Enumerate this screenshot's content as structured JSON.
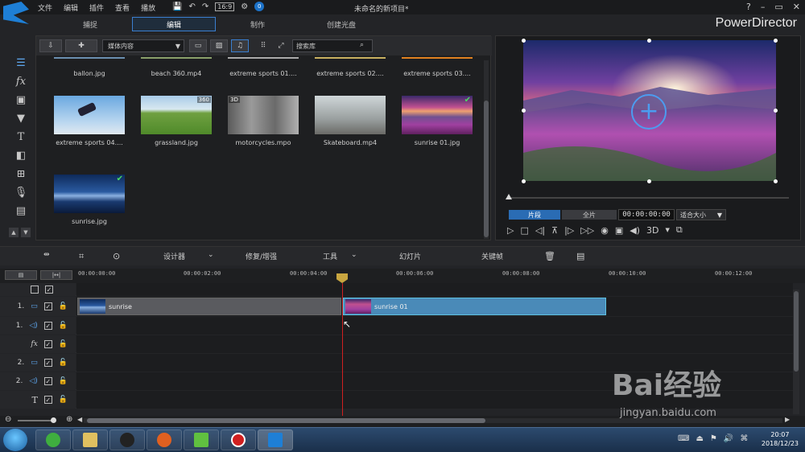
{
  "titlebar": {
    "menu": [
      "文件",
      "编辑",
      "插件",
      "查看",
      "播放"
    ],
    "project_title": "未命名的新项目*",
    "window_controls": [
      "?",
      "–",
      "▭",
      "✕"
    ]
  },
  "modes": [
    "捕捉",
    "编辑",
    "制作",
    "创建光盘"
  ],
  "brand": "PowerDirector",
  "library": {
    "media_select": "媒体内容",
    "search_placeholder": "搜索库",
    "items": [
      {
        "label": "ballon.jpg"
      },
      {
        "label": "beach 360.mp4"
      },
      {
        "label": "extreme sports 01...."
      },
      {
        "label": "extreme sports 02...."
      },
      {
        "label": "extreme sports 03...."
      },
      {
        "label": "extreme sports 04....",
        "tag": ""
      },
      {
        "label": "grassland.jpg",
        "tag": "360"
      },
      {
        "label": "motorcycles.mpo",
        "tag": "3D"
      },
      {
        "label": "Skateboard.mp4",
        "tag": ""
      },
      {
        "label": "sunrise 01.jpg",
        "check": "✔"
      },
      {
        "label": "sunrise.jpg",
        "check": "✔"
      }
    ]
  },
  "preview": {
    "tab_clip": "片段",
    "tab_full": "全片",
    "timecode": "00:00:00:00",
    "fit": "适合大小",
    "mode3d": "3D"
  },
  "timeline_toolbar": {
    "designer": "设计器",
    "fix": "修复/增强",
    "tools": "工具",
    "slideshow": "幻灯片",
    "keyframe": "关键帧"
  },
  "ruler_ticks": [
    "00:00:00:00",
    "00:00:02:00",
    "00:00:04:00",
    "00:00:06:00",
    "00:00:08:00",
    "00:00:10:00",
    "00:00:12:00"
  ],
  "tracks": [
    {
      "num": "",
      "type": "master"
    },
    {
      "num": "1.",
      "type": "video"
    },
    {
      "num": "1.",
      "type": "audio"
    },
    {
      "num": "",
      "type": "fx",
      "label": "fx"
    },
    {
      "num": "2.",
      "type": "video"
    },
    {
      "num": "2.",
      "type": "audio"
    },
    {
      "num": "",
      "type": "title",
      "label": "T"
    }
  ],
  "clips": {
    "clip1": "sunrise",
    "clip2": "sunrise 01"
  },
  "taskbar": {
    "time": "20:07",
    "date": "2018/12/23"
  },
  "watermark": {
    "text": "Bai经验",
    "url": "jingyan.baidu.com"
  },
  "colors": {
    "accent": "#2a6cb4",
    "playhead": "#d02020",
    "check": "#4cd964"
  }
}
